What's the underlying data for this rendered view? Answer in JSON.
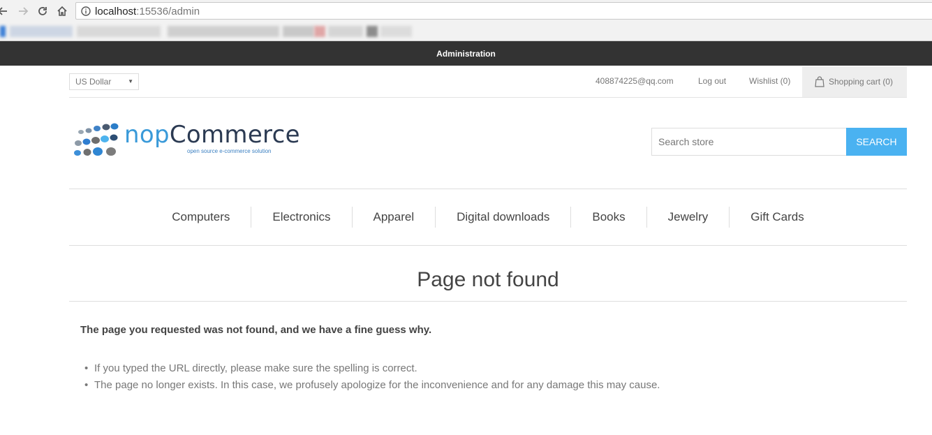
{
  "browser": {
    "url_host": "localhost",
    "url_rest": ":15536/admin",
    "icons": [
      "back-arrow-icon",
      "forward-arrow-icon",
      "reload-icon",
      "home-icon",
      "info-icon"
    ]
  },
  "admin_bar": {
    "label": "Administration",
    "bg": "#333333"
  },
  "header": {
    "currency": "US Dollar",
    "account_email": "408874225@qq.com",
    "logout": "Log out",
    "wishlist": "Wishlist (0)",
    "cart": "Shopping cart (0)"
  },
  "logo": {
    "brand_nop": "nop",
    "brand_commerce": "Commerce",
    "tagline": "open source e-commerce solution"
  },
  "search": {
    "placeholder": "Search store",
    "button": "SEARCH",
    "accent": "#4ab2f1"
  },
  "menu": {
    "items": [
      {
        "label": "Computers"
      },
      {
        "label": "Electronics"
      },
      {
        "label": "Apparel"
      },
      {
        "label": "Digital downloads"
      },
      {
        "label": "Books"
      },
      {
        "label": "Jewelry"
      },
      {
        "label": "Gift Cards"
      }
    ]
  },
  "content": {
    "title": "Page not found",
    "lead": "The page you requested was not found, and we have a fine guess why.",
    "reasons": [
      "If you typed the URL directly, please make sure the spelling is correct.",
      "The page no longer exists. In this case, we profusely apologize for the inconvenience and for any damage this may cause."
    ]
  }
}
